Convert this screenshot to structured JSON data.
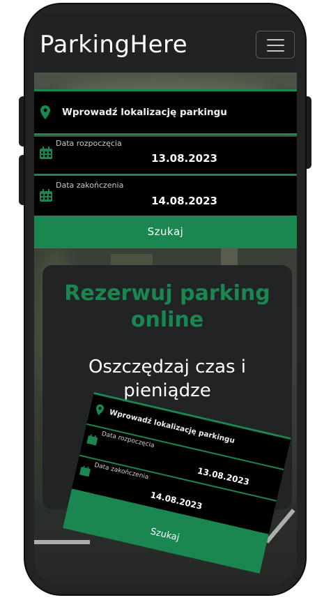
{
  "app": {
    "brand": "ParkingHere"
  },
  "search": {
    "location_label": "Wprowadź lokalizację parkingu",
    "start_label": "Data rozpoczęcia",
    "start_value": "13.08.2023",
    "end_label": "Data zakończenia",
    "end_value": "14.08.2023",
    "button_label": "Szukaj"
  },
  "promo": {
    "title": "Rezerwuj parking online",
    "subtitle": "Oszczędzaj czas i pieniądze"
  },
  "preview": {
    "location_label": "Wprowadź lokalizację parkingu",
    "start_label": "Data rozpoczęcia",
    "start_value": "13.08.2023",
    "end_label": "Data zakończenia",
    "end_value": "14.08.2023",
    "button_label": "Szukaj"
  },
  "colors": {
    "accent": "#1a8751",
    "field_bg": "#000000",
    "card_bg": "#222325"
  },
  "icons": [
    "map-pin-icon",
    "calendar-icon",
    "hamburger-icon"
  ]
}
